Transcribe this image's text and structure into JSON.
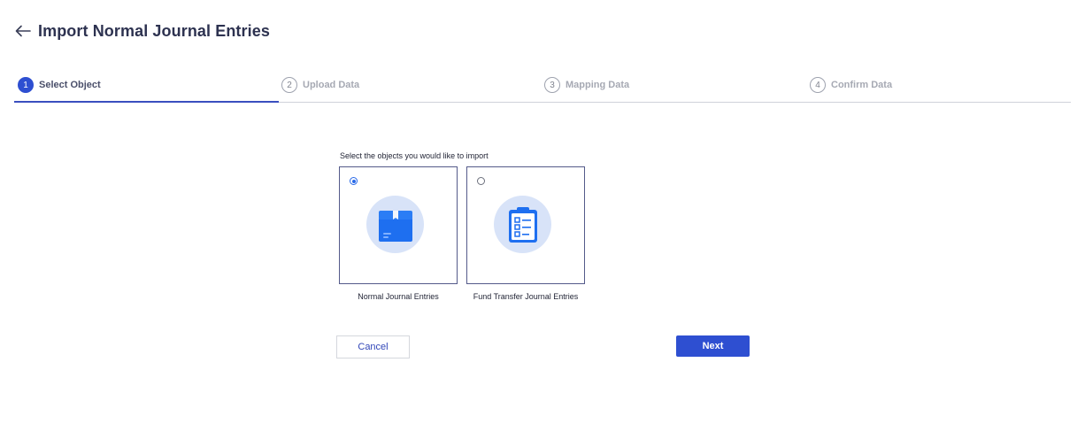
{
  "header": {
    "back_icon": "arrow-left-icon",
    "title": "Import Normal Journal Entries"
  },
  "stepper": {
    "steps": [
      {
        "number": "1",
        "label": "Select Object",
        "active": true
      },
      {
        "number": "2",
        "label": "Upload Data",
        "active": false
      },
      {
        "number": "3",
        "label": "Mapping Data",
        "active": false
      },
      {
        "number": "4",
        "label": "Confirm Data",
        "active": false
      }
    ]
  },
  "selection": {
    "prompt": "Select the objects you would like to import",
    "options": [
      {
        "label": "Normal Journal Entries",
        "icon": "box-icon",
        "selected": true
      },
      {
        "label": "Fund Transfer Journal Entries",
        "icon": "clipboard-checklist-icon",
        "selected": false
      }
    ]
  },
  "actions": {
    "cancel_label": "Cancel",
    "next_label": "Next"
  },
  "colors": {
    "primary": "#2e4fd1",
    "icon_bg": "#d8e3f8",
    "icon_fg": "#1e6ff0"
  }
}
